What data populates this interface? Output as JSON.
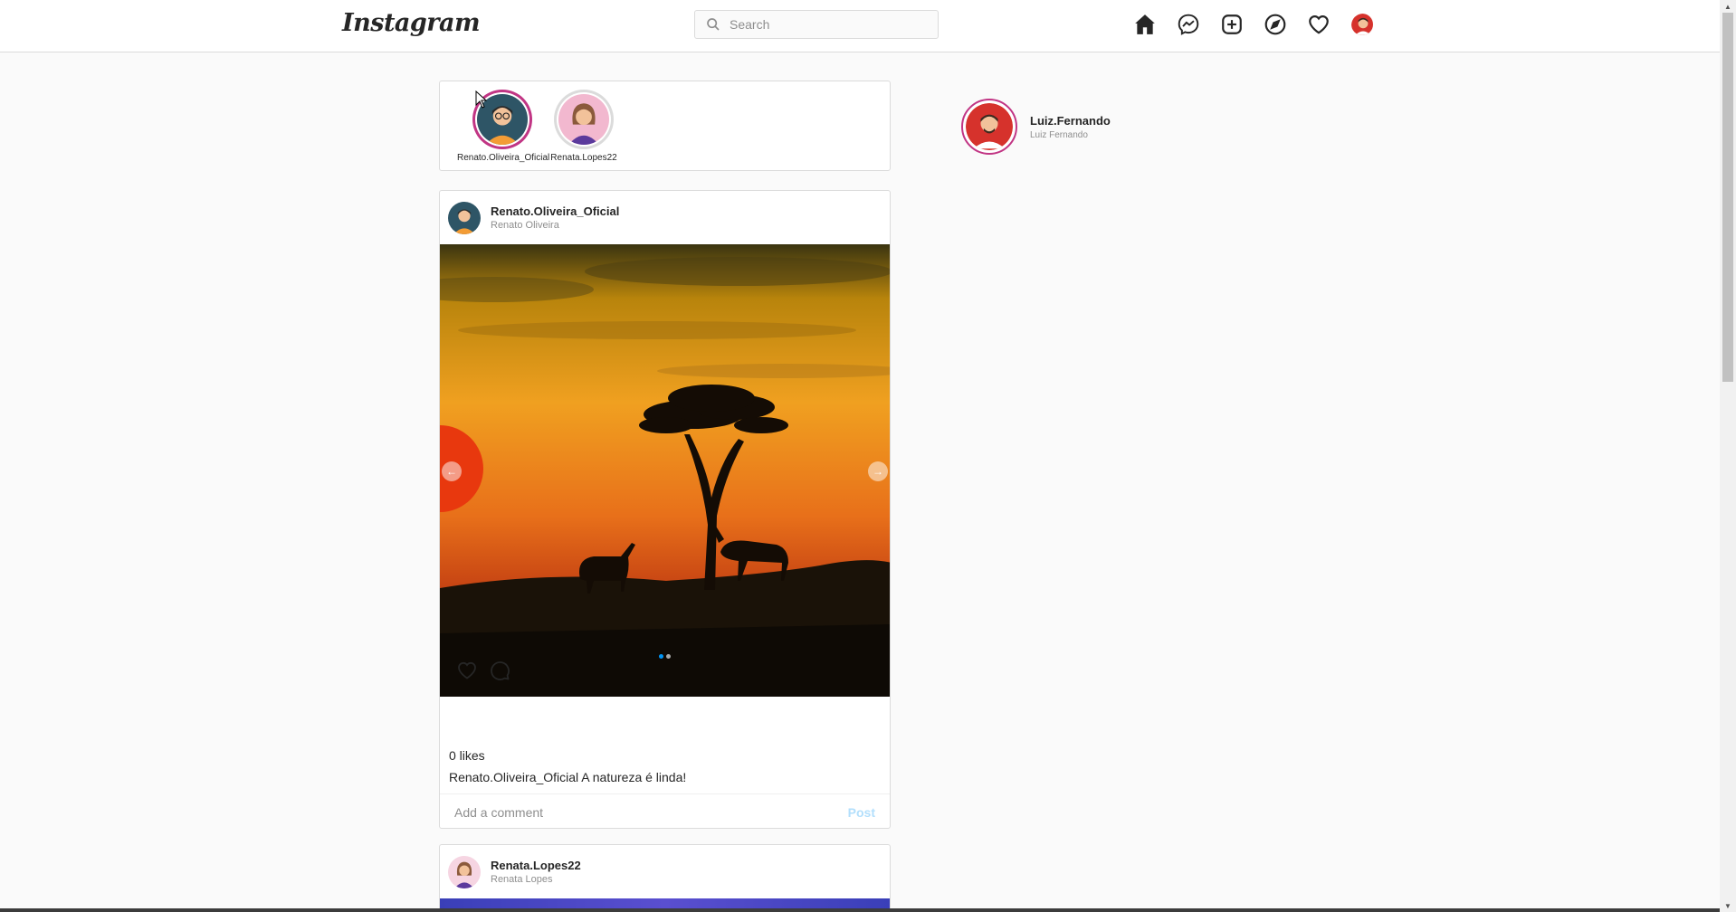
{
  "header": {
    "logo": "Instagram",
    "search_placeholder": "Search",
    "nav_icons": [
      "home-icon",
      "messenger-icon",
      "new-post-icon",
      "explore-icon",
      "activity-heart-icon",
      "profile-avatar"
    ]
  },
  "stories": [
    {
      "username": "Renato.Oliveira_Oficial",
      "state": "active"
    },
    {
      "username": "Renata.Lopes22",
      "state": "seen"
    }
  ],
  "posts": [
    {
      "username": "Renato.Oliveira_Oficial",
      "full_name": "Renato Oliveira",
      "likes": "0 likes",
      "caption_user": "Renato.Oliveira_Oficial",
      "caption_text": "A natureza é linda!",
      "carousel_count": 2,
      "carousel_index": 0,
      "comment_placeholder": "Add a comment",
      "post_label": "Post"
    },
    {
      "username": "Renata.Lopes22",
      "full_name": "Renata Lopes"
    }
  ],
  "profile": {
    "username": "Luiz.Fernando",
    "full_name": "Luiz Fernando"
  },
  "colors": {
    "story_ring": "#c13584",
    "accent": "#0095f6",
    "post_button_disabled": "#b2dffc"
  }
}
